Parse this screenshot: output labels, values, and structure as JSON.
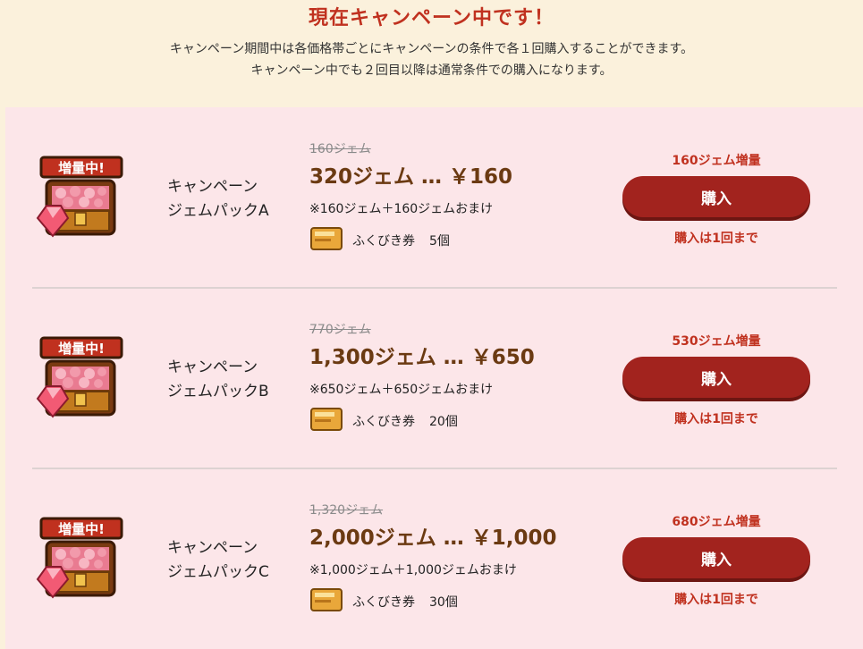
{
  "header": {
    "title": "現在キャンペーン中です！",
    "desc_line1": "キャンペーン期間中は各価格帯ごとにキャンペーンの条件で各１回購入することができます。",
    "desc_line2": "キャンペーン中でも２回目以降は通常条件での購入になります。"
  },
  "packs": [
    {
      "icon_badge": "増量中!",
      "name_line1": "キャンペーン",
      "name_line2": "ジェムパックA",
      "old_amount": "160ジェム",
      "main": "320ジェム … ￥160",
      "bonus_text": "※160ジェム＋160ジェムおまけ",
      "ticket_label": "ふくびき券",
      "ticket_count": "5個",
      "increase_label": "160ジェム増量",
      "buy_label": "購入",
      "limit_label": "購入は1回まで"
    },
    {
      "icon_badge": "増量中!",
      "name_line1": "キャンペーン",
      "name_line2": "ジェムパックB",
      "old_amount": "770ジェム",
      "main": "1,300ジェム … ￥650",
      "bonus_text": "※650ジェム＋650ジェムおまけ",
      "ticket_label": "ふくびき券",
      "ticket_count": "20個",
      "increase_label": "530ジェム増量",
      "buy_label": "購入",
      "limit_label": "購入は1回まで"
    },
    {
      "icon_badge": "増量中!",
      "name_line1": "キャンペーン",
      "name_line2": "ジェムパックC",
      "old_amount": "1,320ジェム",
      "main": "2,000ジェム … ￥1,000",
      "bonus_text": "※1,000ジェム＋1,000ジェムおまけ",
      "ticket_label": "ふくびき券",
      "ticket_count": "30個",
      "increase_label": "680ジェム増量",
      "buy_label": "購入",
      "limit_label": "購入は1回まで"
    }
  ],
  "colors": {
    "accent_red": "#c0311f",
    "button": "#a2231e",
    "price_brown": "#6b3a12",
    "panel_bg": "#fce6e9",
    "page_bg": "#fbf1dc"
  },
  "icons": [
    "gem-chest-icon",
    "ticket-icon"
  ]
}
